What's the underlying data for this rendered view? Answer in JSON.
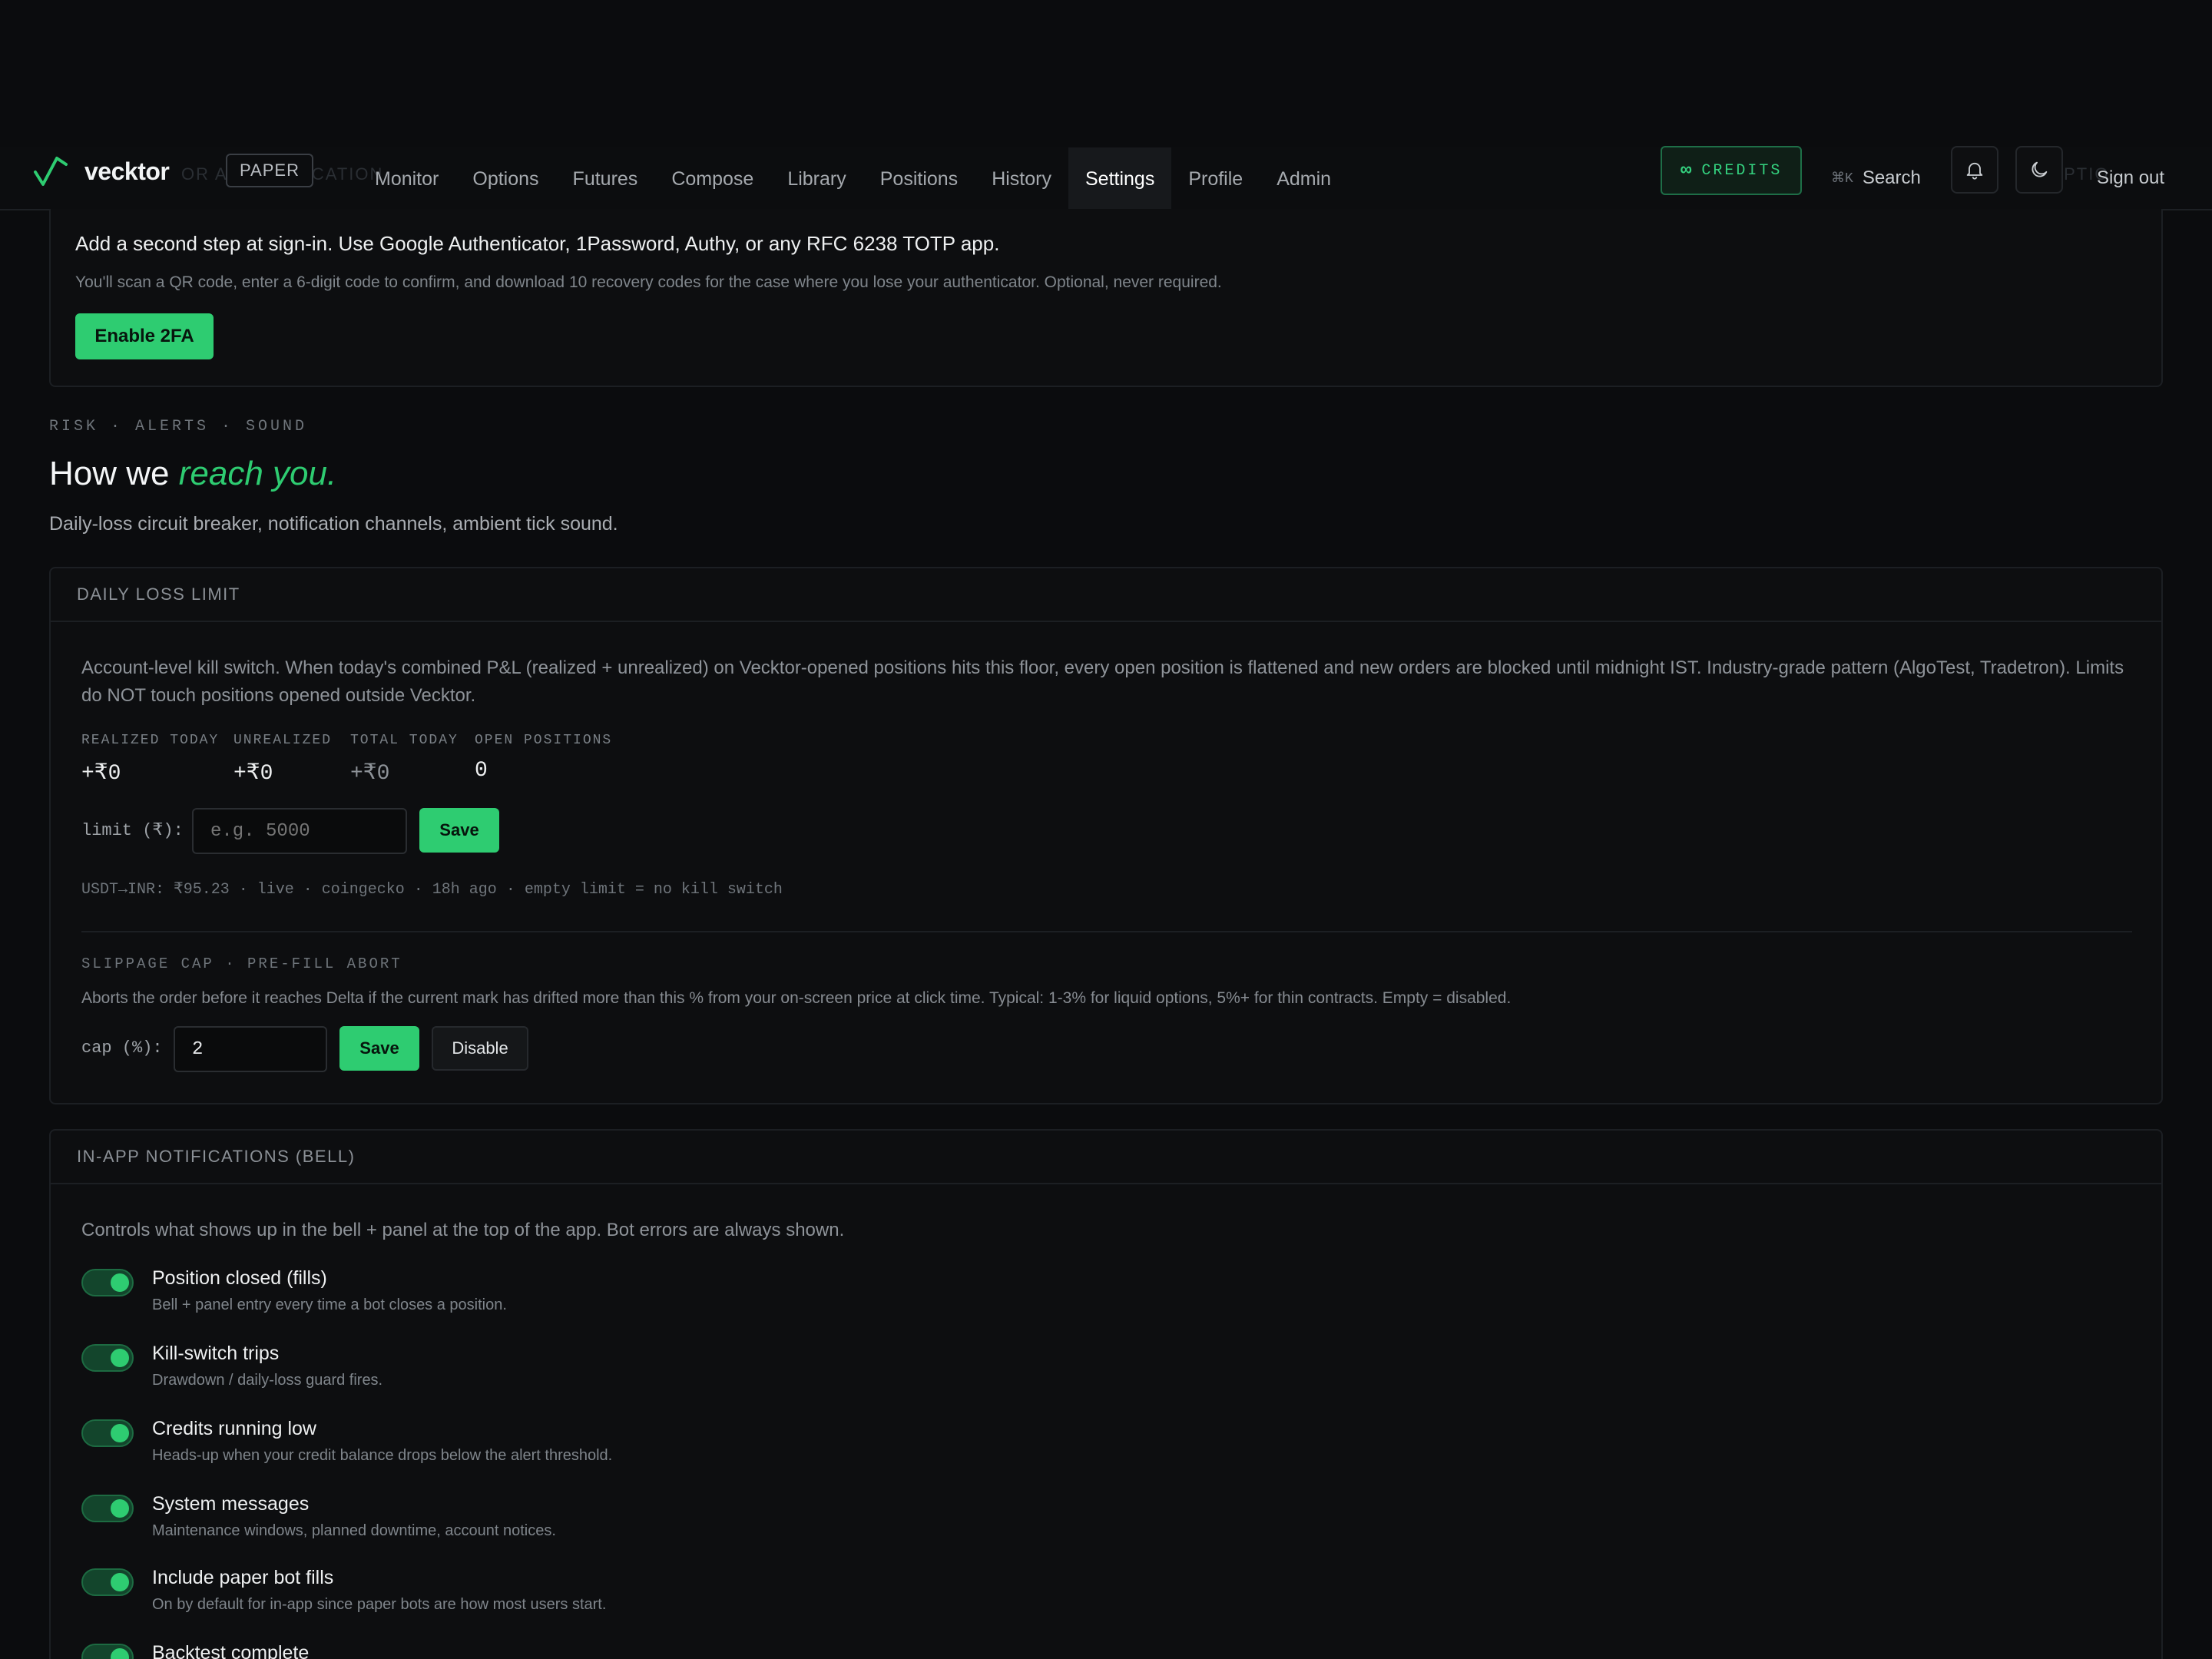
{
  "header": {
    "logo_text": "vecktor",
    "ghost_left": "OR AUTHENTICATION",
    "ghost_right": "OPTIO",
    "paper_badge": "PAPER",
    "nav": [
      "Monitor",
      "Options",
      "Futures",
      "Compose",
      "Library",
      "Positions",
      "History",
      "Settings",
      "Profile",
      "Admin"
    ],
    "active_nav": "Settings",
    "credits_symbol": "∞",
    "credits_label": "CREDITS",
    "search_kbd": "⌘K",
    "search_label": "Search",
    "signout_label": "Sign out"
  },
  "twofa": {
    "title": "Add a second step at sign-in. Use Google Authenticator, 1Password, Authy, or any RFC 6238 TOTP app.",
    "desc": "You'll scan a QR code, enter a 6-digit code to confirm, and download 10 recovery codes for the case where you lose your authenticator. Optional, never required.",
    "button": "Enable 2FA"
  },
  "section": {
    "eyebrow": "RISK · ALERTS · SOUND",
    "heading_plain": "How we ",
    "heading_accent": "reach you.",
    "subtitle": "Daily-loss circuit breaker, notification channels, ambient tick sound."
  },
  "daily_loss": {
    "header": "DAILY LOSS LIMIT",
    "desc": "Account-level kill switch. When today's combined P&L (realized + unrealized) on Vecktor-opened positions hits this floor, every open position is flattened and new orders are blocked until midnight IST. Industry-grade pattern (AlgoTest, Tradetron). Limits do NOT touch positions opened outside Vecktor.",
    "stats": [
      {
        "label": "REALIZED TODAY",
        "value": "+₹0"
      },
      {
        "label": "UNREALIZED",
        "value": "+₹0"
      },
      {
        "label": "TOTAL TODAY",
        "value": "+₹0"
      },
      {
        "label": "OPEN POSITIONS",
        "value": "0"
      }
    ],
    "limit_label": "limit (₹):",
    "limit_placeholder": "e.g. 5000",
    "save_label": "Save",
    "footnote": "USDT→INR: ₹95.23 · live · coingecko · 18h ago · empty limit = no kill switch",
    "slippage_eyebrow": "SLIPPAGE CAP · PRE-FILL ABORT",
    "slippage_desc": "Aborts the order before it reaches Delta if the current mark has drifted more than this % from your on-screen price at click time. Typical: 1-3% for liquid options, 5%+ for thin contracts. Empty = disabled.",
    "cap_label": "cap (%):",
    "cap_value": "2",
    "cap_save": "Save",
    "cap_disable": "Disable"
  },
  "notifications": {
    "header": "IN-APP NOTIFICATIONS (BELL)",
    "desc": "Controls what shows up in the bell + panel at the top of the app. Bot errors are always shown.",
    "items": [
      {
        "title": "Position closed (fills)",
        "desc": "Bell + panel entry every time a bot closes a position.",
        "on": true
      },
      {
        "title": "Kill-switch trips",
        "desc": "Drawdown / daily-loss guard fires.",
        "on": true
      },
      {
        "title": "Credits running low",
        "desc": "Heads-up when your credit balance drops below the alert threshold.",
        "on": true
      },
      {
        "title": "System messages",
        "desc": "Maintenance windows, planned downtime, account notices.",
        "on": true
      },
      {
        "title": "Include paper bot fills",
        "desc": "On by default for in-app since paper bots are how most users start.",
        "on": true
      },
      {
        "title": "Backtest complete",
        "desc": "",
        "on": true
      }
    ]
  },
  "colors": {
    "accent": "#2ecc71",
    "background": "#0b0c0e"
  }
}
